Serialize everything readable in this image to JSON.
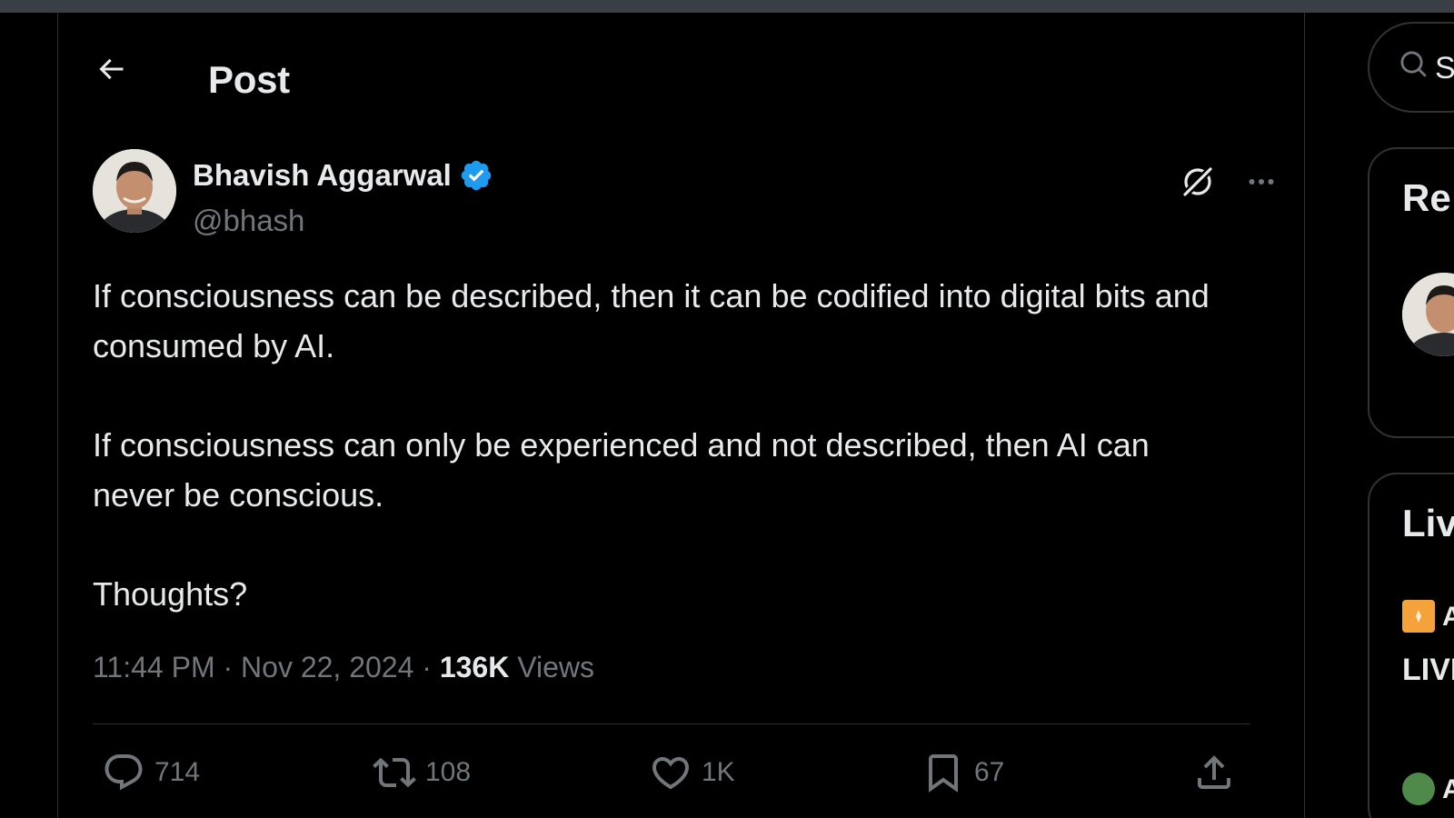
{
  "header": {
    "title": "Post"
  },
  "post": {
    "author_name": "Bhavish Aggarwal",
    "author_handle": "@bhash",
    "paragraphs": [
      "If consciousness can be described, then it can be codified into digital bits and consumed by AI.",
      "If consciousness can only be experienced and not described, then AI can never be conscious.",
      "Thoughts?"
    ],
    "time": "11:44 PM",
    "date": "Nov 22, 2024",
    "separator": "·",
    "views_count": "136K",
    "views_label": "Views",
    "replies": "714",
    "reposts": "108",
    "likes": "1K",
    "bookmarks": "67"
  },
  "sidebar": {
    "search_placeholder_visible": "S",
    "relevant_title_visible": "Re",
    "live_title_visible": "Liv",
    "live_text_visible": "LIVI",
    "live_item1_visible": "A",
    "live_item2_visible": "A"
  },
  "colors": {
    "background": "#000000",
    "text_primary": "#e7e9ea",
    "text_secondary": "#71767b",
    "border": "#2f3336",
    "verified_blue": "#1d9bf0"
  },
  "icons": {
    "back": "arrow-left-icon",
    "verified": "verified-badge-icon",
    "grok": "grok-icon",
    "more": "more-horizontal-icon",
    "reply": "reply-icon",
    "repost": "repost-icon",
    "like": "heart-icon",
    "bookmark": "bookmark-icon",
    "share": "share-icon",
    "search": "search-icon"
  }
}
